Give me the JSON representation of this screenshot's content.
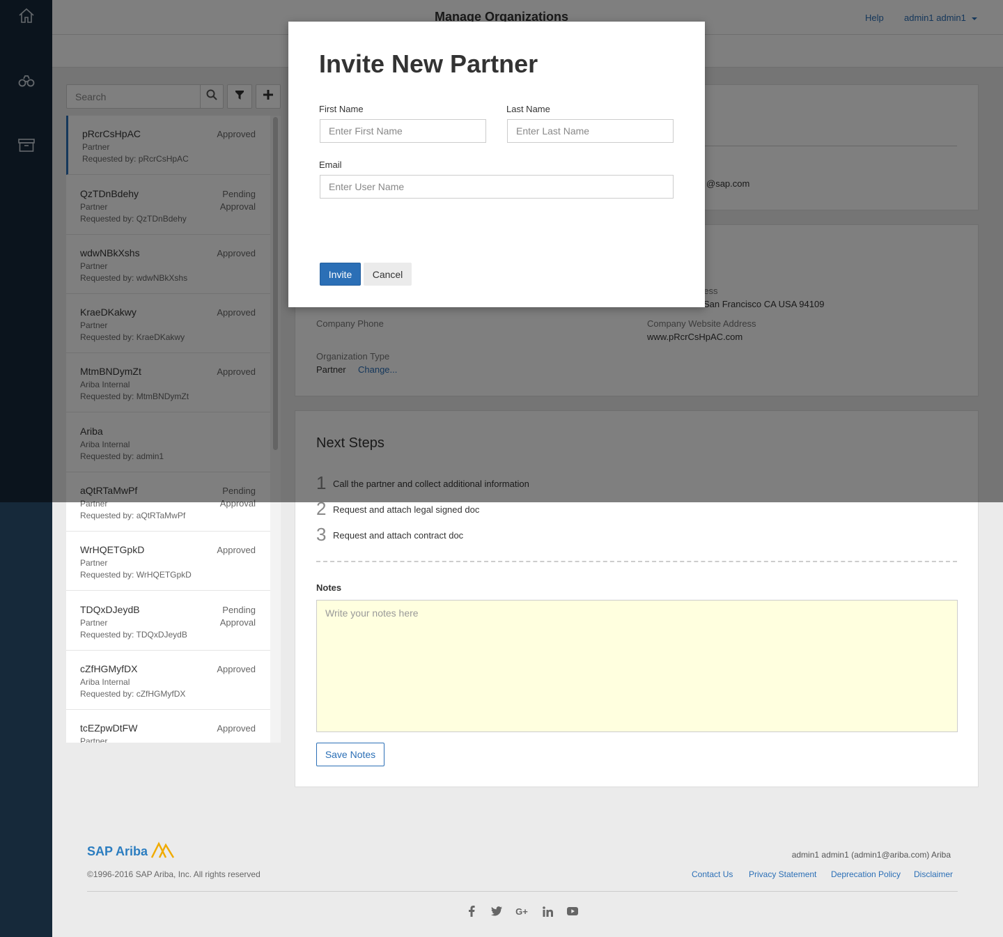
{
  "header": {
    "title": "Manage Organizations",
    "help_label": "Help",
    "user_label": "admin1 admin1"
  },
  "nav": {
    "items": [
      "home-icon",
      "binoculars-icon",
      "archive-icon"
    ]
  },
  "search": {
    "placeholder": "Search"
  },
  "organizations": [
    {
      "name": "pRcrCsHpAC",
      "type": "Partner",
      "requested_by": "Requested by: pRcrCsHpAC",
      "status": "Approved"
    },
    {
      "name": "QzTDnBdehy",
      "type": "Partner",
      "requested_by": "Requested by: QzTDnBdehy",
      "status": "Pending Approval"
    },
    {
      "name": "wdwNBkXshs",
      "type": "Partner",
      "requested_by": "Requested by: wdwNBkXshs",
      "status": "Approved"
    },
    {
      "name": "KraeDKakwy",
      "type": "Partner",
      "requested_by": "Requested by: KraeDKakwy",
      "status": "Approved"
    },
    {
      "name": "MtmBNDymZt",
      "type": "Ariba Internal",
      "requested_by": "Requested by: MtmBNDymZt",
      "status": "Approved"
    },
    {
      "name": "Ariba",
      "type": "Ariba Internal",
      "requested_by": "Requested by: admin1",
      "status": ""
    },
    {
      "name": "aQtRTaMwPf",
      "type": "Partner",
      "requested_by": "Requested by: aQtRTaMwPf",
      "status": "Pending Approval"
    },
    {
      "name": "WrHQETGpkD",
      "type": "Partner",
      "requested_by": "Requested by: WrHQETGpkD",
      "status": "Approved"
    },
    {
      "name": "TDQxDJeydB",
      "type": "Partner",
      "requested_by": "Requested by: TDQxDJeydB",
      "status": "Pending Approval"
    },
    {
      "name": "cZfHGMyfDX",
      "type": "Ariba Internal",
      "requested_by": "Requested by: cZfHGMyfDX",
      "status": "Approved"
    },
    {
      "name": "tcEZpwDtFW",
      "type": "Partner",
      "requested_by": "",
      "status": "Approved"
    }
  ],
  "details": {
    "email_partial": "@sap.com",
    "address_label_partial": "ress",
    "address_value_partial": "San Francisco CA USA 94109",
    "company_phone_label": "Company Phone",
    "website_label": "Company Website Address",
    "website_value": "www.pRcrCsHpAC.com",
    "org_type_label": "Organization Type",
    "org_type_value": "Partner",
    "change_link": "Change..."
  },
  "next_steps": {
    "title": "Next Steps",
    "steps": [
      {
        "num": "1",
        "text": "Call the partner and collect additional information"
      },
      {
        "num": "2",
        "text": "Request and attach legal signed doc"
      },
      {
        "num": "3",
        "text": "Request and attach contract doc"
      }
    ],
    "notes_label": "Notes",
    "notes_placeholder": "Write your notes here",
    "save_notes_label": "Save Notes"
  },
  "footer": {
    "logo_text": "SAP Ariba",
    "copyright": "©1996-2016 SAP Ariba, Inc. All rights reserved",
    "user_info": "admin1 admin1 (admin1@ariba.com) Ariba",
    "links": [
      "Contact Us",
      "Privacy Statement",
      "Deprecation Policy",
      "Disclaimer"
    ],
    "social": [
      "facebook-icon",
      "twitter-icon",
      "google-plus-icon",
      "linkedin-icon",
      "youtube-icon"
    ]
  },
  "modal": {
    "title": "Invite New Partner",
    "first_name_label": "First Name",
    "first_name_placeholder": "Enter First Name",
    "first_name_value": "",
    "last_name_label": "Last Name",
    "last_name_placeholder": "Enter Last Name",
    "last_name_value": "",
    "email_label": "Email",
    "email_placeholder": "Enter User Name",
    "email_value": "",
    "invite_label": "Invite",
    "cancel_label": "Cancel"
  },
  "colors": {
    "nav_bg": "#16293a",
    "primary": "#2b6fb6",
    "notes_bg": "#ffffdf"
  }
}
